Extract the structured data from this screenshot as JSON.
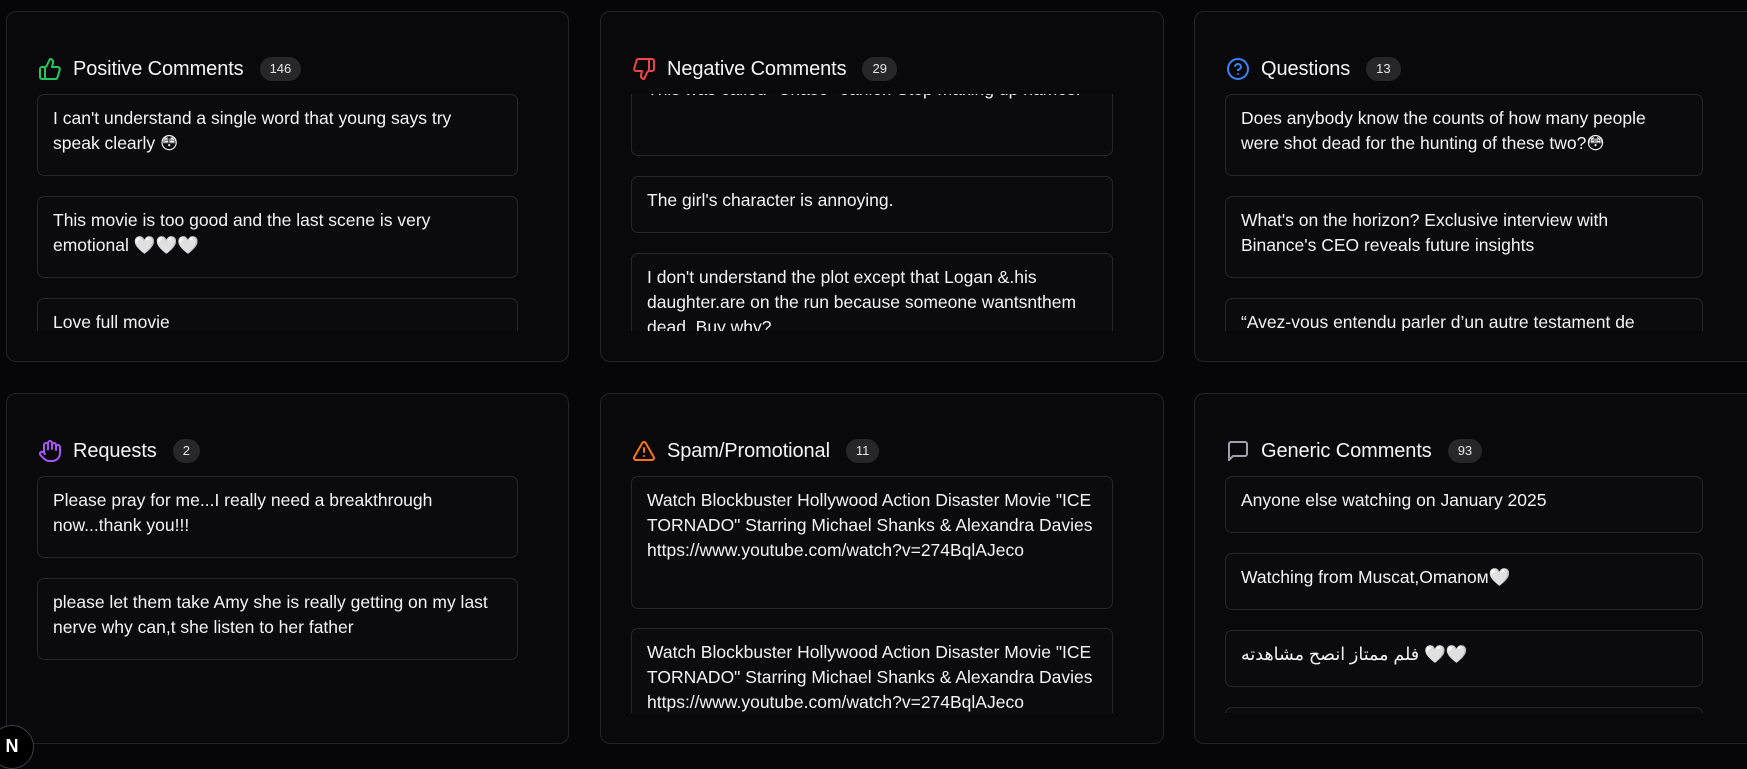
{
  "panels": {
    "positive": {
      "title": "Positive Comments",
      "count": "146",
      "icon": "thumbs-up-icon",
      "color": "#22c55e",
      "items": [
        "I can't understand a single word that young says try speak clearly 😳",
        "This movie is too good and the last scene is very emotional 🤍🤍🤍",
        "Love full movie"
      ]
    },
    "negative": {
      "title": "Negative Comments",
      "count": "29",
      "icon": "thumbs-down-icon",
      "color": "#ef4444",
      "items": [
        "This was called \"Chase\" earlier. Stop making up names.",
        "The girl's character is annoying.",
        "I don't understand the plot except that Logan &.his daughter.are on the run because someone wantsnthem dead. Buy why?"
      ]
    },
    "questions": {
      "title": "Questions",
      "count": "13",
      "icon": "question-circle-icon",
      "color": "#3b82f6",
      "items": [
        "Does anybody know the counts of how many people were shot dead for the hunting of these two?😳",
        "What's on the horizon? Exclusive interview with Binance's CEO reveals future insights",
        "“Avez-vous entendu parler d’un autre testament de"
      ]
    },
    "requests": {
      "title": "Requests",
      "count": "2",
      "icon": "hand-icon",
      "color": "#a855f7",
      "items": [
        "Please pray for me...I really need a breakthrough now...thank you!!!",
        "please let them take Amy she is really getting on my last nerve why can,t she listen to her father"
      ]
    },
    "spam": {
      "title": "Spam/Promotional",
      "count": "11",
      "icon": "warning-triangle-icon",
      "color": "#f97316",
      "items": [
        "Watch Blockbuster Hollywood Action Disaster Movie \"ICE TORNADO\" Starring Michael Shanks & Alexandra Davies https://www.youtube.com/watch?v=274BqlAJeco",
        "Watch Blockbuster Hollywood Action Disaster Movie \"ICE TORNADO\" Starring Michael Shanks & Alexandra Davies https://www.youtube.com/watch?v=274BqlAJeco"
      ]
    },
    "generic": {
      "title": "Generic Comments",
      "count": "93",
      "icon": "message-square-icon",
      "color": "#a1a1aa",
      "items": [
        "Anyone else watching on January 2025",
        "Watching from Muscat,Omanом🤍",
        "فلم ممتاز انصح مشاهدته 🤍🤍",
        ""
      ]
    }
  },
  "corner_badge": "N"
}
